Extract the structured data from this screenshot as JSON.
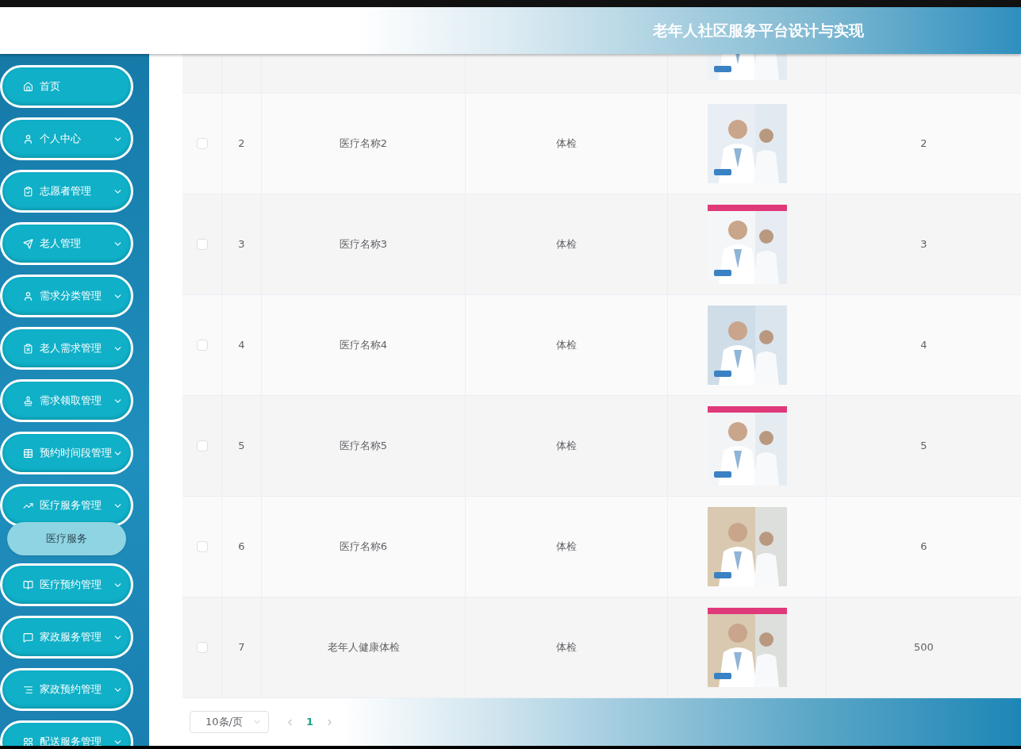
{
  "header": {
    "title": "老年人社区服务平台设计与实现"
  },
  "sidebar": {
    "items": [
      {
        "label": "首页",
        "expandable": false
      },
      {
        "label": "个人中心",
        "expandable": true
      },
      {
        "label": "志愿者管理",
        "expandable": true
      },
      {
        "label": "老人管理",
        "expandable": true
      },
      {
        "label": "需求分类管理",
        "expandable": true
      },
      {
        "label": "老人需求管理",
        "expandable": true
      },
      {
        "label": "需求领取管理",
        "expandable": true
      },
      {
        "label": "预约时间段管理",
        "expandable": true
      },
      {
        "label": "医疗服务管理",
        "expandable": true,
        "children": [
          {
            "label": "医疗服务"
          }
        ]
      },
      {
        "label": "医疗预约管理",
        "expandable": true
      },
      {
        "label": "家政服务管理",
        "expandable": true
      },
      {
        "label": "家政预约管理",
        "expandable": true
      },
      {
        "label": "配送服务管理",
        "expandable": true
      }
    ]
  },
  "table": {
    "rows": [
      {
        "partial": true
      },
      {
        "checked": false,
        "index": "2",
        "name": "医疗名称2",
        "type": "体检",
        "value": "2"
      },
      {
        "checked": false,
        "index": "3",
        "name": "医疗名称3",
        "type": "体检",
        "value": "3"
      },
      {
        "checked": false,
        "index": "4",
        "name": "医疗名称4",
        "type": "体检",
        "value": "4"
      },
      {
        "checked": false,
        "index": "5",
        "name": "医疗名称5",
        "type": "体检",
        "value": "5"
      },
      {
        "checked": false,
        "index": "6",
        "name": "医疗名称6",
        "type": "体检",
        "value": "6"
      },
      {
        "checked": false,
        "index": "7",
        "name": "老年人健康体检",
        "type": "体检",
        "value": "500"
      }
    ]
  },
  "pagination": {
    "page_size": "10条/页",
    "pages": [
      {
        "label": "1",
        "selected": true
      }
    ]
  }
}
